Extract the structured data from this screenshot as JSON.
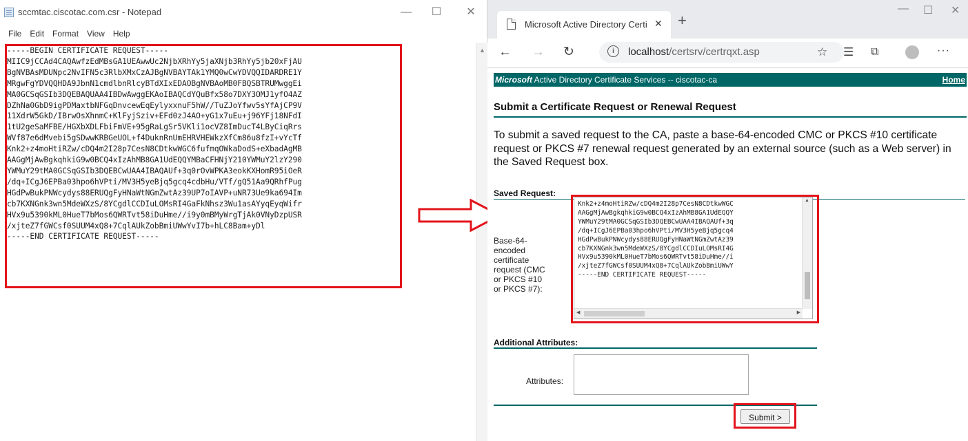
{
  "notepad": {
    "title": "sccmtac.ciscotac.com.csr - Notepad",
    "menu": [
      "File",
      "Edit",
      "Format",
      "View",
      "Help"
    ],
    "content": "-----BEGIN CERTIFICATE REQUEST-----\nMIIC9jCCAd4CAQAwfzEdMBsGA1UEAwwUc2NjbXRhYy5jaXNjb3RhYy5jb20xFjAU\nBgNVBAsMDUNpc2NvIFN5c3RlbXMxCzAJBgNVBAYTAk1YMQ0wCwYDVQQIDARDRE1Y\nMRgwFgYDVQQHDA9JbnN1cmdlbnRlcyBTdXIxEDAOBgNVBAoMB0FBQSBTRUMwggEi\nMA0GCSqGSIb3DQEBAQUAA4IBDwAwggEKAoIBAQCdYQuBfx58o7DXY3OMJ1yfO4AZ\nDZhNa0GbD9igPDMaxtbNFGqDnvcewEqEylyxxnuF5hW//TuZJoYfwv5sYfAjCP9V\n11XdrW5GkD/IBrwOsXhnmC+KlFyjSziv+EFd0zJ4AO+yG1x7uEu+j96YFj18NFdI\n1tU2geSaMFBE/HGXbXDLFbiFmVE+95gRaLgSr5VKli1ocVZ8ImDucT4LByCiqRrs\nWVf87e6dMvebi5gSDwwKRBGeUOL+f4DuknRnUmEHRVHEWkzXfCm86u8fzI+vYcTf\nKnk2+z4moHtiRZw/cDQ4m2I28p7CesN8CDtkwWGC6fufmqOWkaDodS+eXbadAgMB\nAAGgMjAwBgkqhkiG9w0BCQ4xIzAhMB8GA1UdEQQYMBaCFHNjY210YWMuY2lzY290\nYWMuY29tMA0GCSqGSIb3DQEBCwUAA4IBAQAUf+3q0rOvWPKA3eokKXHomR95iOeR\n/dq+ICgJ6EPBa03hpo6hVPti/MV3H5yeBjq5gcq4cdbHu/VTf/gQ51Aa9QRhfPug\nHGdPwBukPNWcydys88ERUQgFyHNaWtNGmZwtAz39UP7oIAVP+uNR73Ue9ka694Im\ncb7KXNGnk3wn5MdeWXzS/8YCgdlCCDIuLOMsRI4GaFkNhsz3Wu1asAYyqEyqWifr\nHVx9u5390kML0HueT7bMos6QWRTvt58iDuHme//i9y0mBMyWrgTjAk0VNyDzpUSR\n/xjteZ7fGWCsf0SUUM4xQ8+7CqlAUkZobBmiUWwYvI7b+hLC8Bam+yDl\n-----END CERTIFICATE REQUEST-----"
  },
  "browser": {
    "tab_title": "Microsoft Active Directory Certifi",
    "url_host": "localhost",
    "url_path": "/certsrv/certrqxt.asp",
    "header_brand": "Microsoft",
    "header_text": " Active Directory Certificate Services  --  ciscotac-ca",
    "home_link": "Home",
    "page_title": "Submit a Certificate Request or Renewal Request",
    "intro": "To submit a saved request to the CA, paste a base-64-encoded CMC or PKCS #10 certificate request or PKCS #7 renewal request generated by an external source (such as a Web server) in the Saved Request box.",
    "saved_request_heading": "Saved Request:",
    "saved_request_label": "Base-64-encoded certificate request (CMC or PKCS #10 or PKCS #7):",
    "saved_request_value": "Knk2+z4moHtiRZw/cDQ4m2I28p7CesN8CDtkwWGC\nAAGgMjAwBgkqhkiG9w0BCQ4xIzAhMB8GA1UdEQQY\nYWMuY29tMA0GCSqGSIb3DQEBCwUAA4IBAQAUf+3q\n/dq+ICgJ6EPBa03hpo6hVPti/MV3H5yeBjq5gcq4\nHGdPwBukPNWcydys88ERUQgFyHNaWtNGmZwtAz39\ncb7KXNGnk3wn5MdeWXzS/8YCgdlCCDIuLOMsRI4G\nHVx9u5390kML0HueT7bMos6QWRTvt58iDuHme//i\n/xjteZ7fGWCsf0SUUM4xQ8+7CqlAUkZobBmiUWwY\n-----END CERTIFICATE REQUEST-----",
    "additional_attributes_heading": "Additional Attributes:",
    "attributes_label": "Attributes:",
    "attributes_value": "",
    "submit_label": "Submit >"
  },
  "colors": {
    "header_bg": "#006666",
    "annotation_red": "#e3141b"
  }
}
